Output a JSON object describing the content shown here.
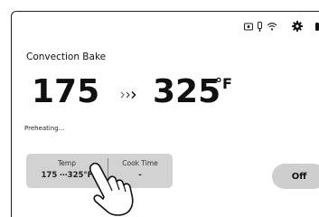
{
  "status_bar": {
    "icons": [
      "remote-icon",
      "probe-icon",
      "wifi-icon",
      "gear-icon",
      "light-icon"
    ]
  },
  "mode": {
    "title": "Convection Bake"
  },
  "temperature": {
    "current": "175",
    "target": "325",
    "unit": "°F",
    "arrow_icon": "triple-arrow-icon"
  },
  "status": {
    "text": "Preheating..."
  },
  "settings": {
    "temp_label": "Temp",
    "temp_value": "175 ⋯325°F",
    "cook_time_label": "Cook Time",
    "cook_time_value": "-"
  },
  "buttons": {
    "off_label": "Off"
  },
  "colors": {
    "panel": "#d2d2d2",
    "button": "#cfcfcf",
    "text": "#111111"
  }
}
